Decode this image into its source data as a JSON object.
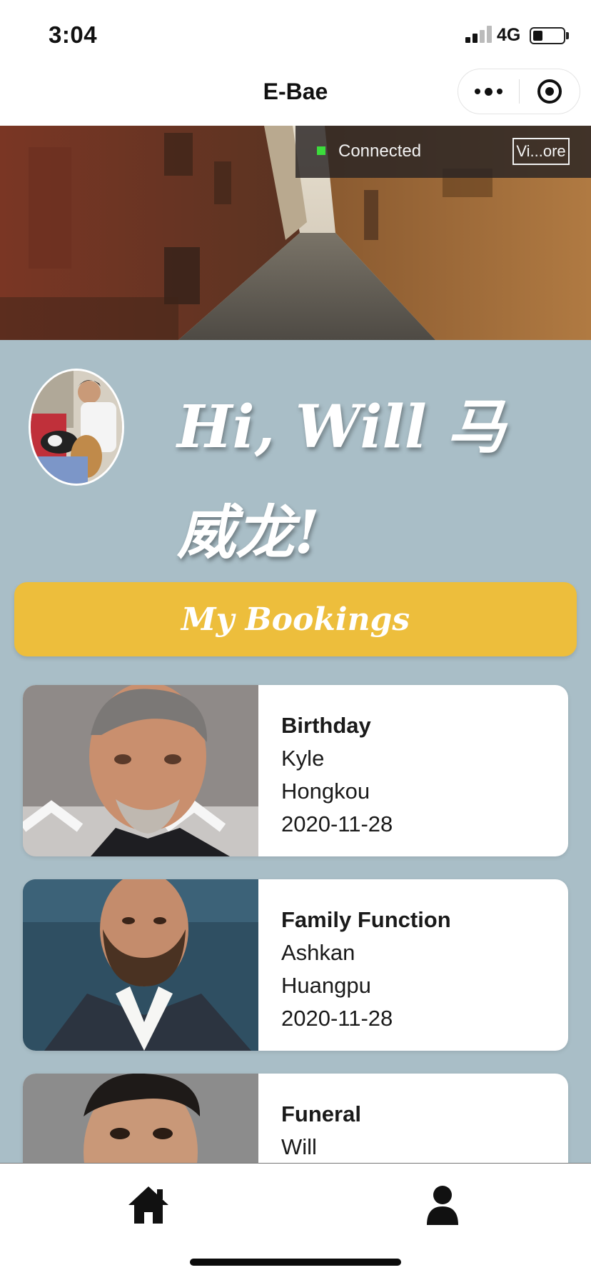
{
  "status_bar": {
    "time": "3:04",
    "network": "4G",
    "signal_bars": 2,
    "battery_level": 0.3
  },
  "nav": {
    "title": "E-Bae",
    "more_icon": "more-dots-icon",
    "close_icon": "target-circle-icon"
  },
  "vconsole": {
    "status": "Connected",
    "status_color": "#3cdc3c",
    "button_label": "Vi...ore"
  },
  "greeting": {
    "line1": "Hi, Will 马",
    "line2": "威龙!"
  },
  "bookings_button": {
    "label": "My Bookings",
    "color": "#edbe3c"
  },
  "bookings": [
    {
      "event": "Birthday",
      "name": "Kyle",
      "location": "Hongkou",
      "date": "2020-11-28"
    },
    {
      "event": "Family Function",
      "name": "Ashkan",
      "location": "Huangpu",
      "date": "2020-11-28"
    },
    {
      "event": "Funeral",
      "name": "Will",
      "location": "",
      "date": ""
    }
  ],
  "tab_bar": {
    "tabs": [
      {
        "icon": "home-icon"
      },
      {
        "icon": "user-icon"
      }
    ]
  },
  "colors": {
    "page_background": "#a9bec7",
    "card_background": "#ffffff"
  }
}
